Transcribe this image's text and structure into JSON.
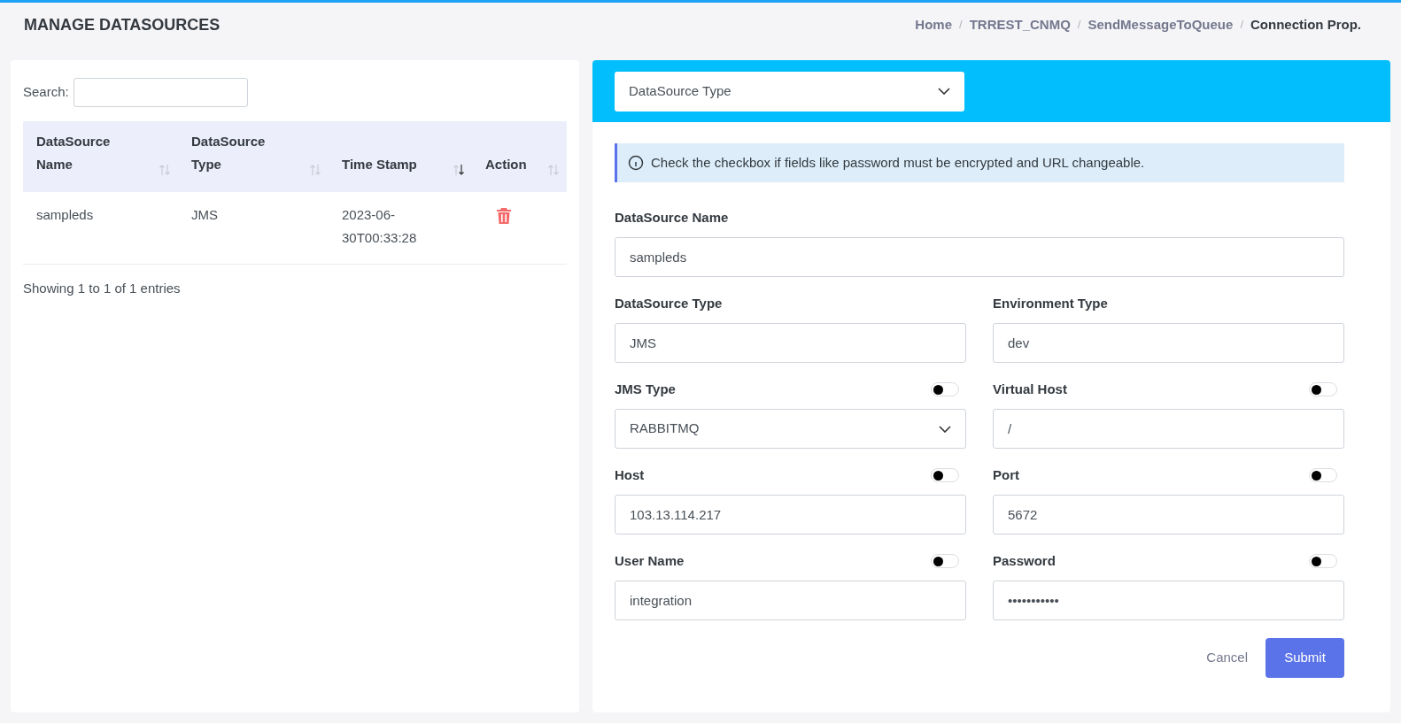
{
  "page_title": "MANAGE DATASOURCES",
  "breadcrumb": [
    {
      "label": "Home",
      "current": false
    },
    {
      "label": "TRREST_CNMQ",
      "current": false
    },
    {
      "label": "SendMessageToQueue",
      "current": false
    },
    {
      "label": "Connection Prop.",
      "current": true
    }
  ],
  "breadcrumb_separator": "/",
  "search": {
    "label": "Search:"
  },
  "table": {
    "columns": [
      {
        "label": "DataSource Name",
        "sorted": false
      },
      {
        "label": "DataSource Type",
        "sorted": false
      },
      {
        "label": "Time Stamp",
        "sorted": true
      },
      {
        "label": "Action",
        "sorted": false
      }
    ],
    "rows": [
      {
        "name": "sampleds",
        "type": "JMS",
        "timestamp": "2023-06-30T00:33:28"
      }
    ]
  },
  "table_info": "Showing 1 to 1 of 1 entries",
  "type_select": {
    "value": "DataSource Type"
  },
  "notice": "Check the checkbox if fields like password must be encrypted and URL changeable.",
  "form_rows": [
    [
      {
        "label": "DataSource Name",
        "kind": "text",
        "value": "sampleds"
      }
    ],
    [
      {
        "label": "DataSource Type",
        "kind": "text",
        "value": "JMS"
      },
      {
        "label": "Environment Type",
        "kind": "text",
        "value": "dev"
      }
    ],
    [
      {
        "label": "JMS Type",
        "kind": "select",
        "value": "RABBITMQ",
        "toggle": {
          "on": false
        }
      },
      {
        "label": "Virtual Host",
        "kind": "text",
        "value": "/",
        "toggle": {
          "on": false
        }
      }
    ],
    [
      {
        "label": "Host",
        "kind": "text",
        "value": "103.13.114.217",
        "toggle": {
          "on": false
        }
      },
      {
        "label": "Port",
        "kind": "text",
        "value": "5672",
        "toggle": {
          "on": false
        }
      }
    ],
    [
      {
        "label": "User Name",
        "kind": "text",
        "value": "integration",
        "toggle": {
          "on": false
        }
      },
      {
        "label": "Password",
        "kind": "text",
        "value": "•••••••••••",
        "toggle": {
          "on": false
        }
      }
    ]
  ],
  "buttons": {
    "cancel": "Cancel",
    "submit": "Submit"
  }
}
